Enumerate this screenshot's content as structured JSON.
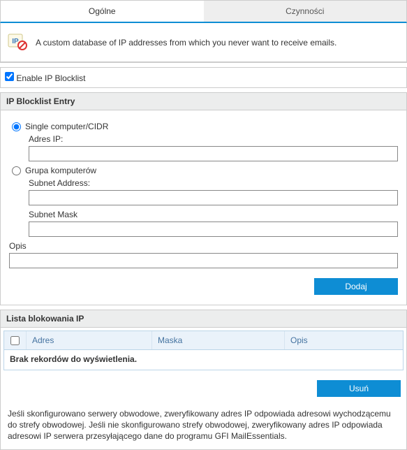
{
  "tabs": {
    "general": "Ogólne",
    "actions": "Czynności"
  },
  "info": {
    "text": "A custom database of IP addresses from which you never want to receive emails."
  },
  "enable": {
    "checked": true,
    "label": "Enable IP Blocklist"
  },
  "entry": {
    "header": "IP Blocklist Entry",
    "single": {
      "selected": true,
      "label": "Single computer/CIDR",
      "ip_label": "Adres IP:",
      "ip_value": ""
    },
    "group": {
      "selected": false,
      "label": "Grupa komputerów",
      "subnet_addr_label": "Subnet Address:",
      "subnet_addr_value": "",
      "subnet_mask_label": "Subnet Mask",
      "subnet_mask_value": ""
    },
    "opis_label": "Opis",
    "opis_value": "",
    "add_btn": "Dodaj"
  },
  "list": {
    "header": "Lista blokowania IP",
    "cols": {
      "addr": "Adres",
      "mask": "Maska",
      "opis": "Opis"
    },
    "empty": "Brak rekordów do wyświetlenia.",
    "delete_btn": "Usuń"
  },
  "footnote": "Jeśli skonfigurowano serwery obwodowe, zweryfikowany adres IP odpowiada adresowi wychodzącemu do strefy obwodowej. Jeśli nie skonfigurowano strefy obwodowej, zweryfikowany adres IP odpowiada adresowi IP serwera przesyłającego dane do programu GFI MailEssentials."
}
